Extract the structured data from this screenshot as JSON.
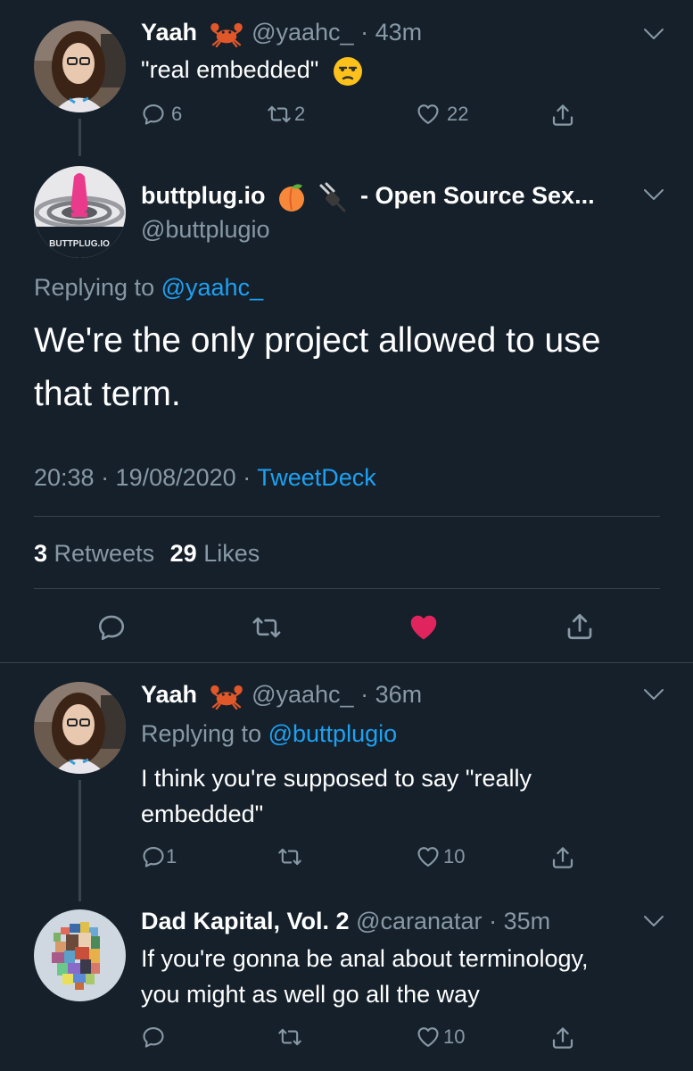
{
  "tweet1": {
    "name": "Yaah",
    "handle": "@yaahc_",
    "sep": "·",
    "time": "43m",
    "text": "\"real embedded\"",
    "replies": "6",
    "retweets": "2",
    "likes": "22"
  },
  "main_tweet": {
    "name": "buttplug.io",
    "name_suffix": "- Open Source Sex...",
    "handle": "@buttplugio",
    "avatar_label": "BUTTPLUG.IO",
    "replying_prefix": "Replying to",
    "replying_to": "@yaahc_",
    "text_line1": "We're the only project allowed to use",
    "text_line2": "that term.",
    "timestamp": "20:38 · 19/08/2020 ·",
    "source": "TweetDeck",
    "retweet_count": "3",
    "retweet_label": "Retweets",
    "like_count": "29",
    "like_label": "Likes"
  },
  "reply1": {
    "name": "Yaah",
    "handle": "@yaahc_",
    "sep": "·",
    "time": "36m",
    "replying_prefix": "Replying to",
    "replying_to": "@buttplugio",
    "text_line1": "I think you're supposed to say \"really",
    "text_line2": "embedded\"",
    "replies": "1",
    "likes": "10"
  },
  "reply2": {
    "name": "Dad Kapital, Vol. 2",
    "handle": "@caranatar",
    "sep": "·",
    "time": "35m",
    "text_line1": "If you're gonna be anal about terminology,",
    "text_line2": "you might as well go all the way",
    "likes": "10"
  },
  "icons": {
    "reply": "reply-icon",
    "retweet": "retweet-icon",
    "like": "heart-icon",
    "share": "share-icon",
    "more": "chevron-down-icon"
  },
  "colors": {
    "background": "#15202b",
    "muted": "#8899a6",
    "link": "#1da1f2",
    "liked": "#e0245e",
    "divider": "#38444d"
  }
}
